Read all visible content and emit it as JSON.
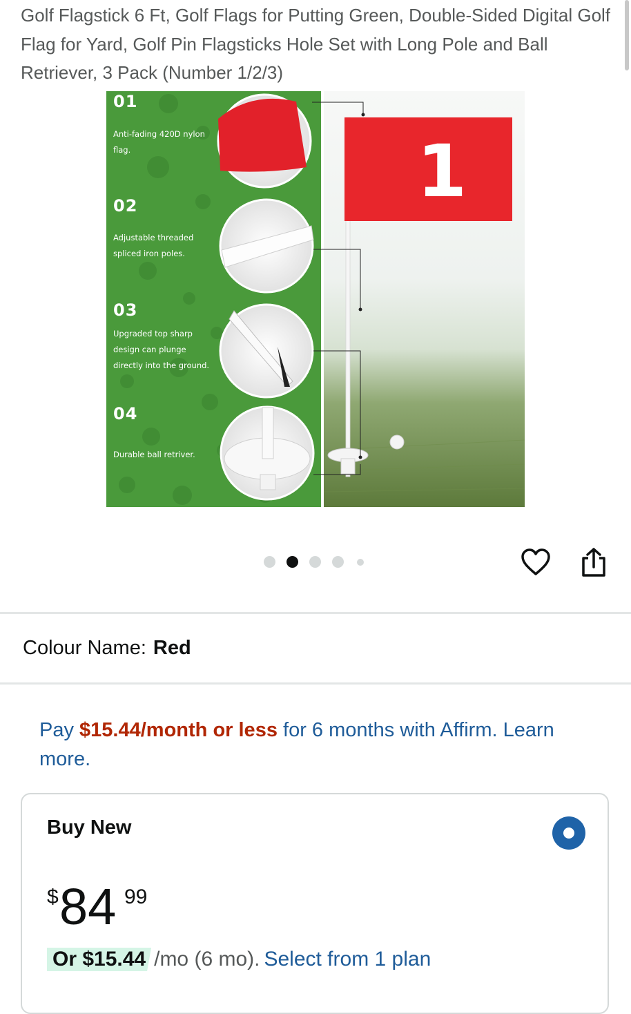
{
  "product": {
    "title": "Golf Flagstick 6 Ft, Golf Flags for Putting Green, Double-Sided Digital Golf Flag for Yard, Golf Pin Flagsticks Hole Set with Long Pole and Ball Retriever, 3 Pack (Number 1/2/3)"
  },
  "image": {
    "flag_number": "1",
    "features": [
      {
        "num": "01",
        "text": "Anti-fading 420D nylon flag."
      },
      {
        "num": "02",
        "text": "Adjustable threaded spliced iron poles."
      },
      {
        "num": "03",
        "text": "Upgraded top sharp design can plunge directly into the ground."
      },
      {
        "num": "04",
        "text": "Durable ball retriver."
      }
    ]
  },
  "carousel": {
    "count": 5,
    "active_index": 1
  },
  "actions": {
    "wishlist_icon": "heart-icon",
    "share_icon": "share-icon"
  },
  "colour": {
    "label": "Colour Name:",
    "value": "Red"
  },
  "affirm": {
    "prefix": "Pay",
    "amount": "$15.44/month or less",
    "suffix": "for 6 months with Affirm.",
    "link": "Learn more."
  },
  "buy_new": {
    "title": "Buy New",
    "price_symbol": "$",
    "price_whole": "84",
    "price_fraction": "99",
    "monthly_highlight": "Or $15.44",
    "monthly_rest": "/mo (6 mo).",
    "monthly_link": "Select from 1 plan",
    "selected": true
  },
  "colors": {
    "link": "#1f5c99",
    "price_red": "#b12704",
    "radio": "#1f63a8",
    "image_green": "#4a9a3b",
    "flag_red": "#e8262c"
  }
}
